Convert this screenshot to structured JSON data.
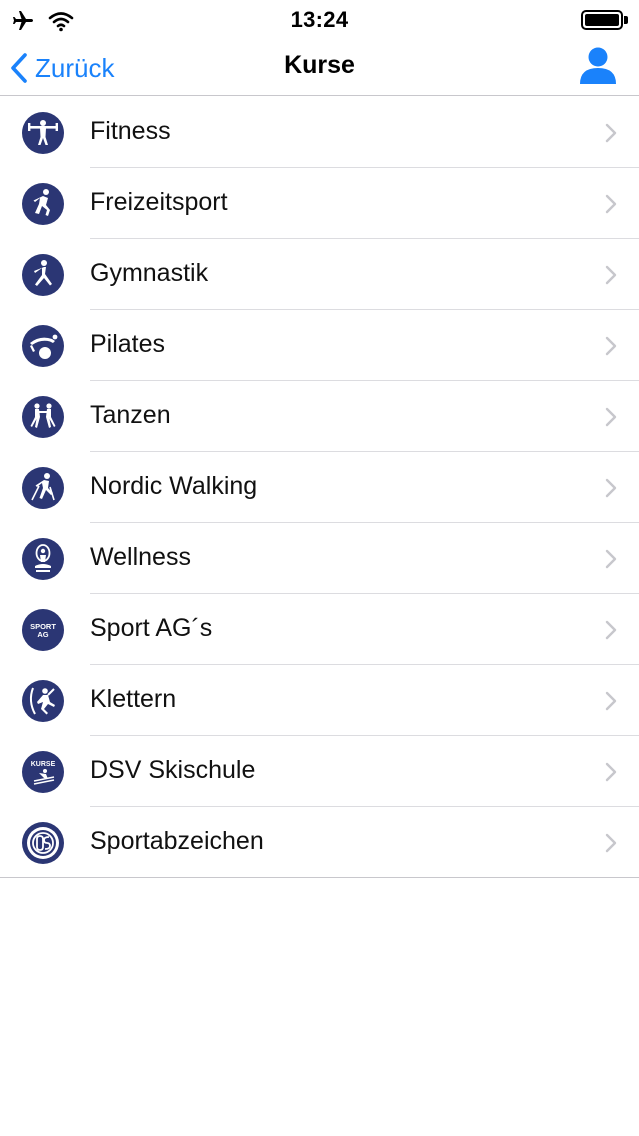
{
  "status_bar": {
    "time": "13:24"
  },
  "nav": {
    "back_label": "Zurück",
    "title": "Kurse",
    "accent_color": "#1a82fb"
  },
  "courses": [
    {
      "label": "Fitness",
      "icon": "fitness-icon"
    },
    {
      "label": "Freizeitsport",
      "icon": "running-icon"
    },
    {
      "label": "Gymnastik",
      "icon": "gymnastics-icon"
    },
    {
      "label": "Pilates",
      "icon": "pilates-icon"
    },
    {
      "label": "Tanzen",
      "icon": "dance-icon"
    },
    {
      "label": "Nordic Walking",
      "icon": "nordic-walking-icon"
    },
    {
      "label": "Wellness",
      "icon": "wellness-icon"
    },
    {
      "label": "Sport AG´s",
      "icon": "sport-ag-icon",
      "icon_text_1": "SPORT",
      "icon_text_2": "AG"
    },
    {
      "label": "Klettern",
      "icon": "climbing-icon"
    },
    {
      "label": "DSV Skischule",
      "icon": "ski-school-icon",
      "icon_text_1": "KURSE"
    },
    {
      "label": "Sportabzeichen",
      "icon": "sport-badge-icon"
    }
  ],
  "icon_color": "#2b3674"
}
